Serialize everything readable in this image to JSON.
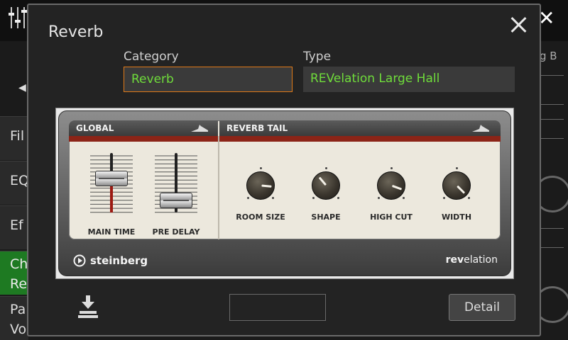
{
  "background": {
    "close_symbol": "✕",
    "left_arrow": "◀",
    "sidebar_items": [
      "Fil",
      "EQ",
      "Ef",
      "Ch\nRe",
      "Pa\nVo"
    ],
    "right_label": "g B"
  },
  "dialog": {
    "title": "Reverb",
    "category_label": "Category",
    "category_value": "Reverb",
    "type_label": "Type",
    "type_value": "REVelation Large Hall",
    "detail_label": "Detail",
    "accent_color": "#6fdc3a",
    "focus_color": "#e07a18"
  },
  "plugin": {
    "global_title": "GLOBAL",
    "tail_title": "REVERB TAIL",
    "faders": [
      {
        "label": "MAIN TIME",
        "level": 0.6
      },
      {
        "label": "PRE DELAY",
        "level": 0.1
      }
    ],
    "knobs": [
      {
        "label": "ROOM SIZE",
        "angle_deg": 95
      },
      {
        "label": "SHAPE",
        "angle_deg": -40
      },
      {
        "label": "HIGH CUT",
        "angle_deg": 110
      },
      {
        "label": "WIDTH",
        "angle_deg": 135
      }
    ],
    "brand": "steinberg",
    "product_bold": "rev",
    "product_rest": "elation"
  }
}
